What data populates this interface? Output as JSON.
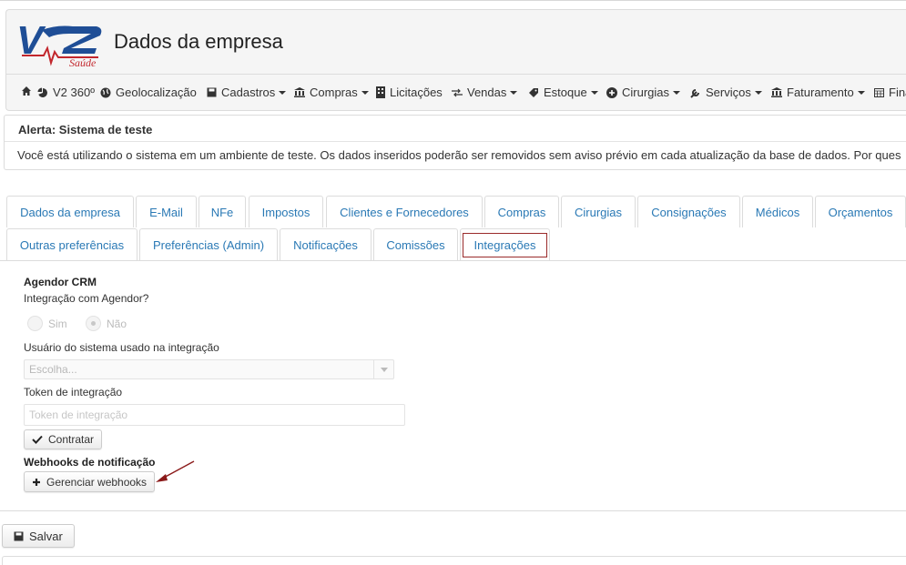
{
  "header": {
    "logo_text": "V2",
    "logo_subtext": "Saúde",
    "title": "Dados da empresa"
  },
  "nav": {
    "items": [
      {
        "label": "",
        "icon": "home-icon"
      },
      {
        "label": "V2 360º",
        "icon": "pie-chart-icon"
      },
      {
        "label": "Geolocalização",
        "icon": "globe-icon"
      },
      {
        "label": "Cadastros",
        "icon": "save-icon"
      },
      {
        "label": "Compras",
        "icon": "bank-icon"
      },
      {
        "label": "Licitações",
        "icon": "building-icon"
      },
      {
        "label": "Vendas",
        "icon": "transfer-icon"
      },
      {
        "label": "Estoque",
        "icon": "tag-icon"
      },
      {
        "label": "Cirurgias",
        "icon": "plus-circle-icon"
      },
      {
        "label": "Serviços",
        "icon": "wrench-icon"
      },
      {
        "label": "Faturamento",
        "icon": "bank-icon"
      },
      {
        "label": "Fina",
        "icon": "calendar-icon"
      }
    ]
  },
  "alert": {
    "title": "Alerta: Sistema de teste",
    "text": "Você está utilizando o sistema em um ambiente de teste. Os dados inseridos poderão ser removidos sem aviso prévio em cada atualização da base de dados. Por ques"
  },
  "tabs": {
    "row1": [
      "Dados da empresa",
      "E-Mail",
      "NFe",
      "Impostos",
      "Clientes e Fornecedores",
      "Compras",
      "Cirurgias",
      "Consignações",
      "Médicos",
      "Orçamentos"
    ],
    "row2": [
      "Outras preferências",
      "Preferências (Admin)",
      "Notificações",
      "Comissões",
      "Integrações"
    ],
    "active": "Integrações"
  },
  "form": {
    "agendor_title": "Agendor CRM",
    "integration_question": "Integração com Agendor?",
    "radio_yes": "Sim",
    "radio_no": "Não",
    "user_label": "Usuário do sistema usado na integração",
    "user_placeholder": "Escolha...",
    "token_label": "Token de integração",
    "token_placeholder": "Token de integração",
    "contract_button": "Contratar",
    "webhooks_title": "Webhooks de notificação",
    "webhooks_button": "Gerenciar webhooks"
  },
  "footer": {
    "save_button": "Salvar"
  },
  "colors": {
    "link": "#2a79b5",
    "active_tab_border": "#9a2b2b",
    "annotation_arrow": "#8b1a1a"
  }
}
